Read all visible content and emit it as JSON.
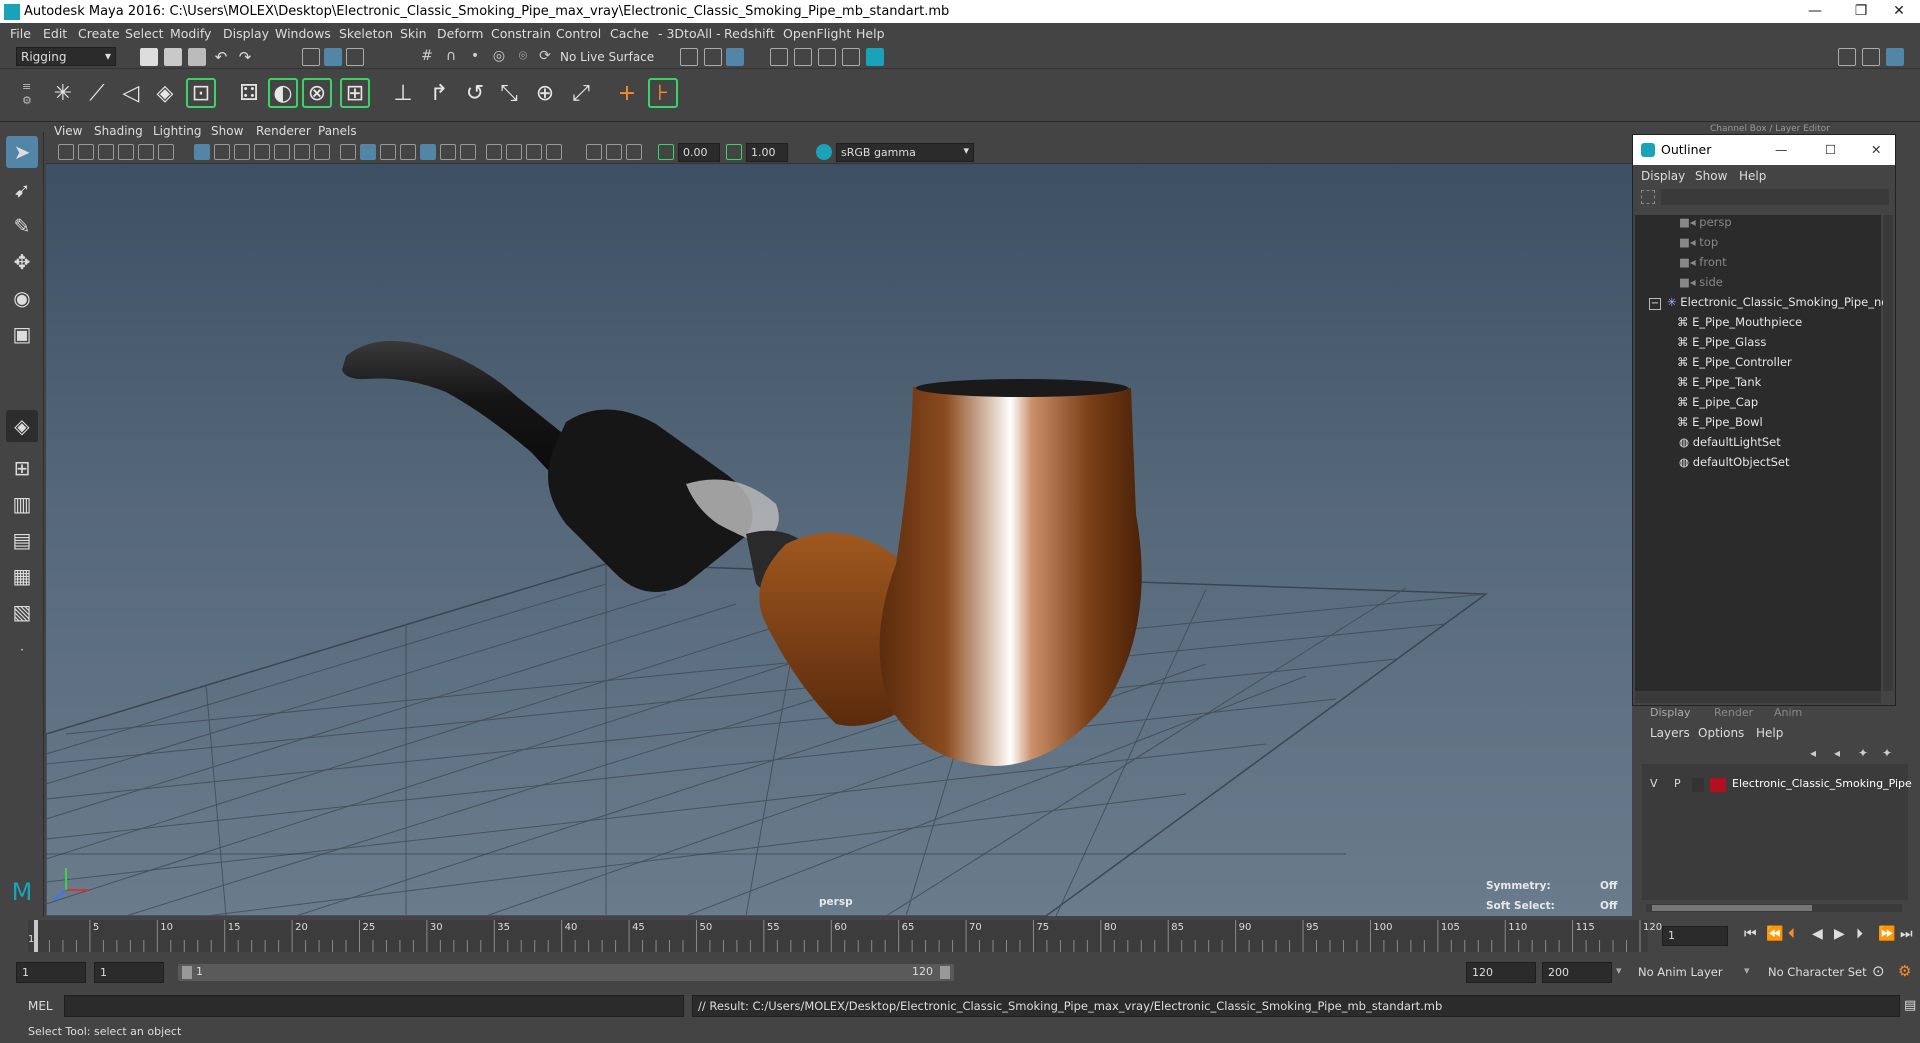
{
  "window": {
    "title": "Autodesk Maya 2016: C:\\Users\\MOLEX\\Desktop\\Electronic_Classic_Smoking_Pipe_max_vray\\Electronic_Classic_Smoking_Pipe_mb_standart.mb",
    "minimize": "—",
    "restore": "❐",
    "close": "✕"
  },
  "menubar": [
    "File",
    "Edit",
    "Create",
    "Select",
    "Modify",
    "Display",
    "Windows",
    "Skeleton",
    "Skin",
    "Deform",
    "Constrain",
    "Control",
    "Cache",
    "- 3DtoAll -",
    "Redshift",
    "OpenFlight",
    "Help"
  ],
  "statusline": {
    "menuset": "Rigging",
    "live_surface": "No Live Surface"
  },
  "viewport": {
    "menus": [
      "View",
      "Shading",
      "Lighting",
      "Show",
      "Renderer",
      "Panels"
    ],
    "exposure": "0.00",
    "gamma": "1.00",
    "color_space": "sRGB gamma",
    "camera_label": "persp",
    "hud": {
      "symmetry_label": "Symmetry:",
      "symmetry_value": "Off",
      "soft_select_label": "Soft Select:",
      "soft_select_value": "Off"
    }
  },
  "outliner": {
    "title": "Outliner",
    "channel_box_label": "Channel Box / Layer Editor",
    "menus": [
      "Display",
      "Show",
      "Help"
    ],
    "cameras": [
      "persp",
      "top",
      "front",
      "side"
    ],
    "group": "Electronic_Classic_Smoking_Pipe_nc",
    "children": [
      "E_Pipe_Mouthpiece",
      "E_Pipe_Glass",
      "E_Pipe_Controller",
      "E_Pipe_Tank",
      "E_pipe_Cap",
      "E_Pipe_Bowl"
    ],
    "sets": [
      "defaultLightSet",
      "defaultObjectSet"
    ]
  },
  "layer_editor": {
    "tabs": [
      "Display",
      "Render",
      "Anim"
    ],
    "menus": [
      "Layers",
      "Options",
      "Help"
    ],
    "layer": {
      "v": "V",
      "p": "P",
      "name": "Electronic_Classic_Smoking_Pipe",
      "color": "#b01020"
    }
  },
  "timeline": {
    "ticks": [
      "5",
      "10",
      "15",
      "20",
      "25",
      "30",
      "35",
      "40",
      "45",
      "50",
      "55",
      "60",
      "65",
      "70",
      "75",
      "80",
      "85",
      "90",
      "95",
      "100",
      "105",
      "110",
      "115",
      "120"
    ],
    "start_tick": "1",
    "current_frame": "1"
  },
  "range": {
    "start": "1",
    "playback_start": "1",
    "slider_start": "1",
    "slider_end": "120",
    "playback_end": "120",
    "end": "200",
    "anim_layer": "No Anim Layer",
    "character_set": "No Character Set"
  },
  "command": {
    "mode": "MEL",
    "result": "// Result: C:/Users/MOLEX/Desktop/Electronic_Classic_Smoking_Pipe_max_vray/Electronic_Classic_Smoking_Pipe_mb_standart.mb"
  },
  "help_line": "Select Tool: select an object",
  "colors": {
    "accent_teal": "#1aa3b8",
    "active_blue": "#5285a6",
    "highlight_green": "#38d468"
  }
}
